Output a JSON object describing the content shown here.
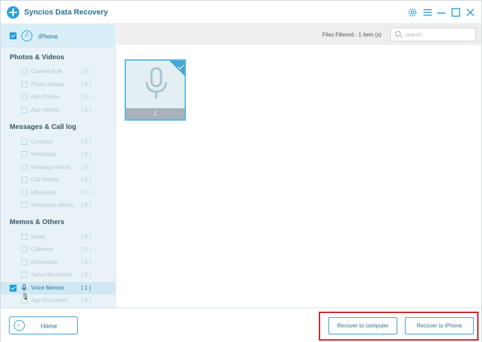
{
  "window": {
    "title": "Syncios Data Recovery"
  },
  "device": {
    "name": "iPhone"
  },
  "sections": [
    {
      "title": "Photos & Videos",
      "items": [
        {
          "label": "Camera Roll",
          "count": "( 0 )"
        },
        {
          "label": "Photo Stream",
          "count": "( 0 )"
        },
        {
          "label": "App Photos",
          "count": "( 0 )"
        },
        {
          "label": "App Videos",
          "count": "( 0 )"
        }
      ]
    },
    {
      "title": "Messages & Call log",
      "items": [
        {
          "label": "Contacts",
          "count": "( 0 )"
        },
        {
          "label": "Messages",
          "count": "( 0 )"
        },
        {
          "label": "Message Attach...",
          "count": "( 0 )"
        },
        {
          "label": "Call History",
          "count": "( 0 )"
        },
        {
          "label": "WhatsApp",
          "count": "( 0 )"
        },
        {
          "label": "WhatsApp Attach...",
          "count": "( 0 )"
        }
      ]
    },
    {
      "title": "Memos & Others",
      "items": [
        {
          "label": "Notes",
          "count": "( 0 )"
        },
        {
          "label": "Calendar",
          "count": "( 0 )"
        },
        {
          "label": "Reminders",
          "count": "( 0 )"
        },
        {
          "label": "Safari Bookmark",
          "count": "( 0 )"
        },
        {
          "label": "Voice Memos",
          "count": "( 1 )"
        },
        {
          "label": "App Document",
          "count": "( 0 )"
        }
      ]
    }
  ],
  "filter": {
    "text": "Files Filtered : 1 item (s)"
  },
  "search": {
    "placeholder": "search"
  },
  "thumbnail": {
    "caption": "1",
    "icon": "microphone-icon"
  },
  "bottom": {
    "home_label": "Home",
    "recover_computer_label": "Recover to computer",
    "recover_iphone_label": "Recover to iPhone"
  },
  "colors": {
    "accent": "#2b9fd6",
    "sidebar_bg": "#e9f3f7",
    "highlight": "#c8222a"
  }
}
